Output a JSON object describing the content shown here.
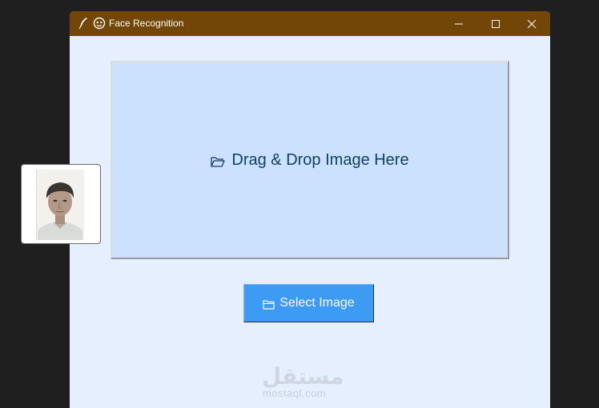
{
  "window": {
    "title": "Face Recognition",
    "colors": {
      "titlebar": "#714607",
      "client": "#e6effd"
    },
    "controls": {
      "minimize": "minimize-icon",
      "maximize": "maximize-icon",
      "close": "close-icon"
    }
  },
  "drop_zone": {
    "label": "Drag & Drop Image Here",
    "icon": "folder-open-icon",
    "colors": {
      "background": "#cce1fd",
      "text": "#0e3f6b"
    }
  },
  "select_button": {
    "label": "Select Image",
    "icon": "folder-icon",
    "color": "#3d9bf3"
  },
  "watermark": {
    "arabic": "مستقل",
    "latin": "mostaql.com"
  },
  "thumbnail": {
    "icon": "portrait-photo"
  }
}
